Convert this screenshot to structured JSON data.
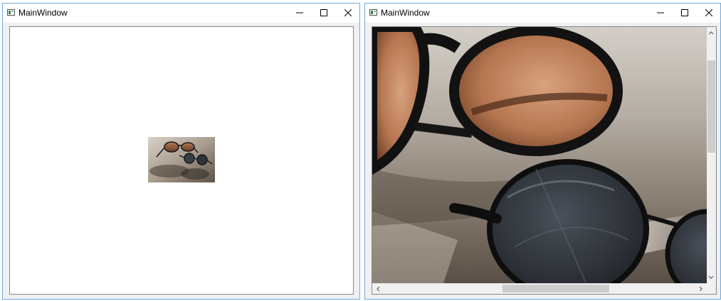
{
  "windows": [
    {
      "title": "MainWindow",
      "mode": "fit-to-view",
      "image": {
        "name": "sunglasses-photo",
        "shown": "thumbnail"
      }
    },
    {
      "title": "MainWindow",
      "mode": "actual-size",
      "image": {
        "name": "sunglasses-photo",
        "shown": "full-resolution"
      },
      "scrollbars": {
        "vertical": {
          "visible": true
        },
        "horizontal": {
          "visible": true
        }
      }
    }
  ],
  "caption_buttons": {
    "minimize_icon": "minimize-icon",
    "maximize_icon": "maximize-icon",
    "close_icon": "close-icon"
  },
  "colors": {
    "window_border": "#6fa8dc",
    "window_bg": "#f0f0f0",
    "titlebar_bg": "#ffffff",
    "viewport_border": "#828790",
    "scroll_thumb": "#cdcdcd"
  }
}
